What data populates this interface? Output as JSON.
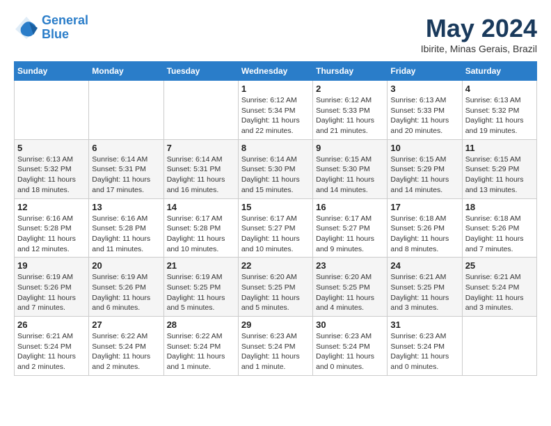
{
  "logo": {
    "line1": "General",
    "line2": "Blue"
  },
  "title": "May 2024",
  "location": "Ibirite, Minas Gerais, Brazil",
  "days_header": [
    "Sunday",
    "Monday",
    "Tuesday",
    "Wednesday",
    "Thursday",
    "Friday",
    "Saturday"
  ],
  "weeks": [
    [
      {
        "day": "",
        "info": ""
      },
      {
        "day": "",
        "info": ""
      },
      {
        "day": "",
        "info": ""
      },
      {
        "day": "1",
        "info": "Sunrise: 6:12 AM\nSunset: 5:34 PM\nDaylight: 11 hours\nand 22 minutes."
      },
      {
        "day": "2",
        "info": "Sunrise: 6:12 AM\nSunset: 5:33 PM\nDaylight: 11 hours\nand 21 minutes."
      },
      {
        "day": "3",
        "info": "Sunrise: 6:13 AM\nSunset: 5:33 PM\nDaylight: 11 hours\nand 20 minutes."
      },
      {
        "day": "4",
        "info": "Sunrise: 6:13 AM\nSunset: 5:32 PM\nDaylight: 11 hours\nand 19 minutes."
      }
    ],
    [
      {
        "day": "5",
        "info": "Sunrise: 6:13 AM\nSunset: 5:32 PM\nDaylight: 11 hours\nand 18 minutes."
      },
      {
        "day": "6",
        "info": "Sunrise: 6:14 AM\nSunset: 5:31 PM\nDaylight: 11 hours\nand 17 minutes."
      },
      {
        "day": "7",
        "info": "Sunrise: 6:14 AM\nSunset: 5:31 PM\nDaylight: 11 hours\nand 16 minutes."
      },
      {
        "day": "8",
        "info": "Sunrise: 6:14 AM\nSunset: 5:30 PM\nDaylight: 11 hours\nand 15 minutes."
      },
      {
        "day": "9",
        "info": "Sunrise: 6:15 AM\nSunset: 5:30 PM\nDaylight: 11 hours\nand 14 minutes."
      },
      {
        "day": "10",
        "info": "Sunrise: 6:15 AM\nSunset: 5:29 PM\nDaylight: 11 hours\nand 14 minutes."
      },
      {
        "day": "11",
        "info": "Sunrise: 6:15 AM\nSunset: 5:29 PM\nDaylight: 11 hours\nand 13 minutes."
      }
    ],
    [
      {
        "day": "12",
        "info": "Sunrise: 6:16 AM\nSunset: 5:28 PM\nDaylight: 11 hours\nand 12 minutes."
      },
      {
        "day": "13",
        "info": "Sunrise: 6:16 AM\nSunset: 5:28 PM\nDaylight: 11 hours\nand 11 minutes."
      },
      {
        "day": "14",
        "info": "Sunrise: 6:17 AM\nSunset: 5:28 PM\nDaylight: 11 hours\nand 10 minutes."
      },
      {
        "day": "15",
        "info": "Sunrise: 6:17 AM\nSunset: 5:27 PM\nDaylight: 11 hours\nand 10 minutes."
      },
      {
        "day": "16",
        "info": "Sunrise: 6:17 AM\nSunset: 5:27 PM\nDaylight: 11 hours\nand 9 minutes."
      },
      {
        "day": "17",
        "info": "Sunrise: 6:18 AM\nSunset: 5:26 PM\nDaylight: 11 hours\nand 8 minutes."
      },
      {
        "day": "18",
        "info": "Sunrise: 6:18 AM\nSunset: 5:26 PM\nDaylight: 11 hours\nand 7 minutes."
      }
    ],
    [
      {
        "day": "19",
        "info": "Sunrise: 6:19 AM\nSunset: 5:26 PM\nDaylight: 11 hours\nand 7 minutes."
      },
      {
        "day": "20",
        "info": "Sunrise: 6:19 AM\nSunset: 5:26 PM\nDaylight: 11 hours\nand 6 minutes."
      },
      {
        "day": "21",
        "info": "Sunrise: 6:19 AM\nSunset: 5:25 PM\nDaylight: 11 hours\nand 5 minutes."
      },
      {
        "day": "22",
        "info": "Sunrise: 6:20 AM\nSunset: 5:25 PM\nDaylight: 11 hours\nand 5 minutes."
      },
      {
        "day": "23",
        "info": "Sunrise: 6:20 AM\nSunset: 5:25 PM\nDaylight: 11 hours\nand 4 minutes."
      },
      {
        "day": "24",
        "info": "Sunrise: 6:21 AM\nSunset: 5:25 PM\nDaylight: 11 hours\nand 3 minutes."
      },
      {
        "day": "25",
        "info": "Sunrise: 6:21 AM\nSunset: 5:24 PM\nDaylight: 11 hours\nand 3 minutes."
      }
    ],
    [
      {
        "day": "26",
        "info": "Sunrise: 6:21 AM\nSunset: 5:24 PM\nDaylight: 11 hours\nand 2 minutes."
      },
      {
        "day": "27",
        "info": "Sunrise: 6:22 AM\nSunset: 5:24 PM\nDaylight: 11 hours\nand 2 minutes."
      },
      {
        "day": "28",
        "info": "Sunrise: 6:22 AM\nSunset: 5:24 PM\nDaylight: 11 hours\nand 1 minute."
      },
      {
        "day": "29",
        "info": "Sunrise: 6:23 AM\nSunset: 5:24 PM\nDaylight: 11 hours\nand 1 minute."
      },
      {
        "day": "30",
        "info": "Sunrise: 6:23 AM\nSunset: 5:24 PM\nDaylight: 11 hours\nand 0 minutes."
      },
      {
        "day": "31",
        "info": "Sunrise: 6:23 AM\nSunset: 5:24 PM\nDaylight: 11 hours\nand 0 minutes."
      },
      {
        "day": "",
        "info": ""
      }
    ]
  ]
}
